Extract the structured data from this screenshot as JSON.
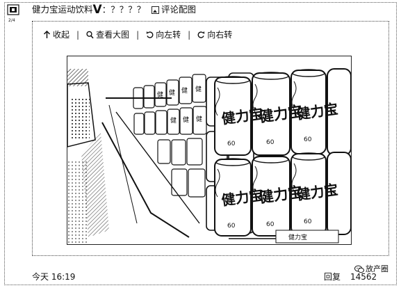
{
  "post": {
    "title": "健力宝运动饮料",
    "title_v": "V",
    "title_suffix": "：？？？？",
    "comment_image_label": "评论配图"
  },
  "toolbar": {
    "collapse_label": "收起",
    "view_large_label": "查看大图",
    "rotate_left_label": "向左转",
    "rotate_right_label": "向右转",
    "separator": "|"
  },
  "image": {
    "can_brand_text": "健力宝",
    "can_number_text": "60",
    "box_label": "健力宝"
  },
  "footer": {
    "time": "今天 16:19",
    "reply_label": "回复",
    "count": "14562"
  },
  "watermark": {
    "text": "放产圈"
  },
  "icons": {
    "avatar": "avatar-icon",
    "comment_image": "image-icon",
    "collapse": "arrow-up-icon",
    "view_large": "magnifier-icon",
    "rotate_left": "rotate-left-icon",
    "rotate_right": "rotate-right-icon",
    "watermark_logo": "wechat-logo-icon"
  }
}
